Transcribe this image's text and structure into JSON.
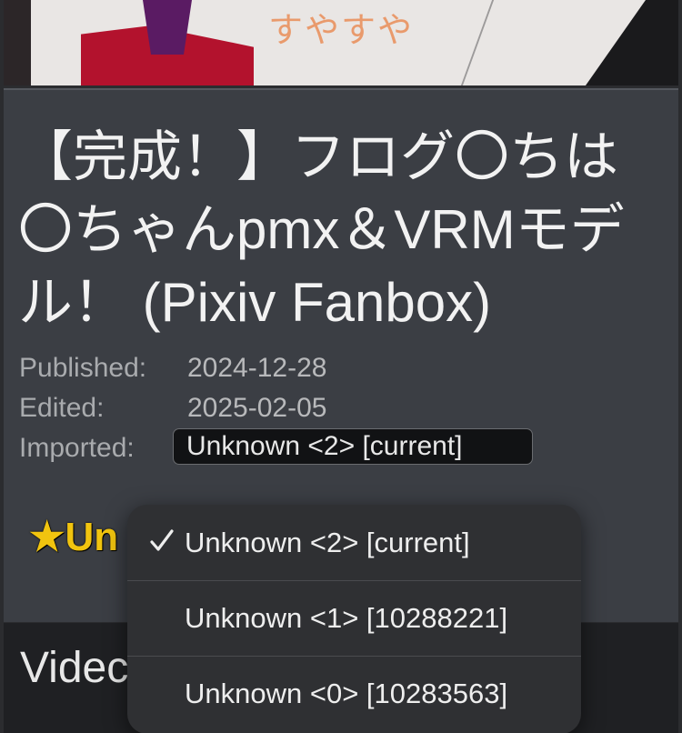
{
  "banner": {
    "text": "すやすや"
  },
  "post": {
    "title": "【完成！】フログ〇ちは〇ちゃんpmx＆VRMモデル！ (Pixiv Fanbox)",
    "published_label": "Published:",
    "published_value": "2024-12-28",
    "edited_label": "Edited:",
    "edited_value": "2025-02-05",
    "imported_label": "Imported:",
    "imported_selected": "Unknown <2> [current]",
    "star_link_text": "★Un"
  },
  "lower": {
    "title": "Videc"
  },
  "dropdown": {
    "options": [
      {
        "label": "Unknown <2> [current]",
        "selected": true
      },
      {
        "label": "Unknown <1> [10288221]",
        "selected": false
      },
      {
        "label": "Unknown <0> [10283563]",
        "selected": false
      }
    ]
  },
  "icons": {
    "check": "checkmark-icon",
    "star": "star-icon"
  },
  "colors": {
    "card_bg": "#3b3e44",
    "star_gold": "#f1c40f",
    "banner_text": "#e99a6c",
    "menu_bg": "#2f3033"
  }
}
